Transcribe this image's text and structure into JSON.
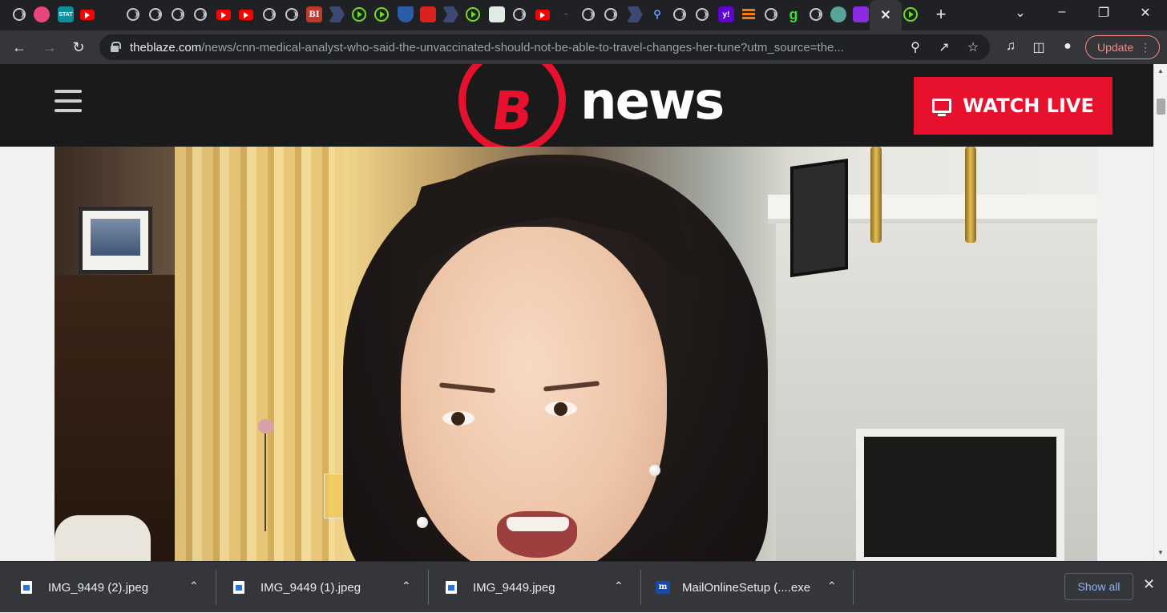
{
  "browser": {
    "url_host": "theblaze.com",
    "url_path": "/news/cnn-medical-analyst-who-said-the-unvaccinated-should-not-be-able-to-travel-changes-her-tune?utm_source=the...",
    "update_label": "Update",
    "tab_icons": [
      "globe-icon",
      "pinwheel-icon",
      "stat-icon",
      "youtube-icon",
      "globe-icon",
      "globe-icon",
      "globe-icon",
      "globe-icon",
      "youtube-icon",
      "youtube-icon",
      "globe-icon",
      "globe-icon",
      "bi-icon",
      "flag-icon",
      "play-icon",
      "play-icon",
      "shield-icon",
      "mic-icon",
      "flag-icon",
      "play-icon",
      "puzzle-icon",
      "globe-icon",
      "youtube-icon",
      "scribble-icon",
      "globe-icon",
      "globe-icon",
      "flag-icon",
      "search-icon",
      "globe-icon",
      "globe-icon",
      "yahoo-icon",
      "bars-icon",
      "globe-icon",
      "g-icon",
      "globe-icon",
      "tree-icon",
      "purple-icon"
    ],
    "tab_texts": {
      "stat": "STAT",
      "bi": "BI",
      "yahoo": "y!",
      "g": "g"
    }
  },
  "site": {
    "logo_letter": "B",
    "logo_text": "news",
    "watch_live_label": "WATCH LIVE"
  },
  "downloads": {
    "items": [
      {
        "name": "IMG_9449 (2).jpeg"
      },
      {
        "name": "IMG_9449 (1).jpeg"
      },
      {
        "name": "IMG_9449.jpeg"
      },
      {
        "name": "MailOnlineSetup (....exe"
      }
    ],
    "show_all_label": "Show all"
  }
}
